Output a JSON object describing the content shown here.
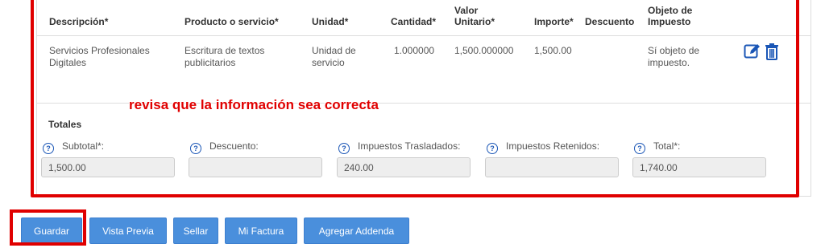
{
  "concepts": {
    "headers": {
      "descripcion": "Descripción*",
      "producto": "Producto o servicio*",
      "unidad": "Unidad*",
      "cantidad": "Cantidad*",
      "valor_line1": "Valor",
      "valor_line2": "Unitario*",
      "importe": "Importe*",
      "descuento": "Descuento",
      "objeto_line1": "Objeto de",
      "objeto_line2": "Impuesto"
    },
    "row": {
      "descripcion_line1": "Servicios Profesionales",
      "descripcion_line2": "Digitales",
      "producto_line1": "Escritura de textos",
      "producto_line2": "publicitarios",
      "unidad_line1": "Unidad de",
      "unidad_line2": "servicio",
      "cantidad": "1.000000",
      "valor_unitario": "1,500.000000",
      "importe": "1,500.00",
      "descuento": "",
      "objeto_line1": "Sí objeto de",
      "objeto_line2": "impuesto."
    },
    "icons": {
      "edit": "edit-icon",
      "delete": "trash-icon"
    }
  },
  "annotation": "revisa que la información sea correcta",
  "totales": {
    "title": "Totales",
    "subtotal_label": "Subtotal*:",
    "subtotal_value": "1,500.00",
    "descuento_label": "Descuento:",
    "descuento_value": "",
    "trasladados_label": "Impuestos Trasladados:",
    "trasladados_value": "240.00",
    "retenidos_label": "Impuestos Retenidos:",
    "retenidos_value": "",
    "total_label": "Total*:",
    "total_value": "1,740.00"
  },
  "buttons": {
    "guardar": "Guardar",
    "vista_previa": "Vista Previa",
    "sellar": "Sellar",
    "mi_factura": "Mi Factura",
    "agregar_addenda": "Agregar Addenda"
  },
  "colors": {
    "accent": "#4a8fdc",
    "annotation_red": "#e00000",
    "help_icon": "#1a56b6"
  }
}
